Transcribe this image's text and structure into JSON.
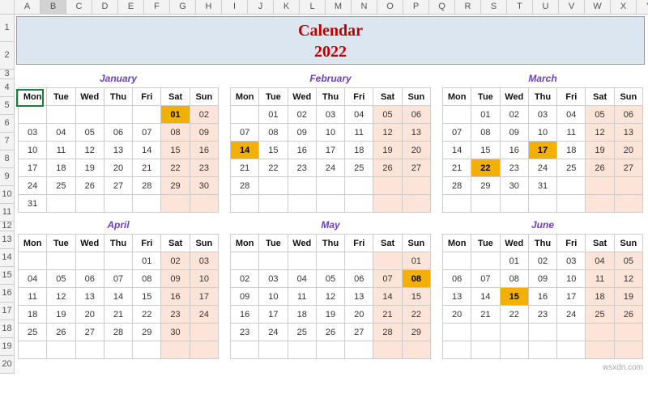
{
  "columns": [
    "A",
    "B",
    "C",
    "D",
    "E",
    "F",
    "G",
    "H",
    "I",
    "J",
    "K",
    "L",
    "M",
    "N",
    "O",
    "P",
    "Q",
    "R",
    "S",
    "T",
    "U",
    "V",
    "W",
    "X",
    "Y"
  ],
  "selected_column": "B",
  "rows": [
    "1",
    "2",
    "3",
    "4",
    "5",
    "6",
    "7",
    "8",
    "9",
    "10",
    "11",
    "12",
    "13",
    "14",
    "15",
    "16",
    "17",
    "18",
    "19",
    "20"
  ],
  "title": {
    "line1": "Calendar",
    "line2": "2022"
  },
  "day_headers": [
    "Mon",
    "Tue",
    "Wed",
    "Thu",
    "Fri",
    "Sat",
    "Sun"
  ],
  "months": [
    {
      "name": "January",
      "weeks": [
        [
          "",
          "",
          "",
          "",
          "",
          "01",
          "02"
        ],
        [
          "03",
          "04",
          "05",
          "06",
          "07",
          "08",
          "09"
        ],
        [
          "10",
          "11",
          "12",
          "13",
          "14",
          "15",
          "16"
        ],
        [
          "17",
          "18",
          "19",
          "20",
          "21",
          "22",
          "23"
        ],
        [
          "24",
          "25",
          "26",
          "27",
          "28",
          "29",
          "30"
        ],
        [
          "31",
          "",
          "",
          "",
          "",
          "",
          ""
        ]
      ],
      "highlights": [
        "01"
      ]
    },
    {
      "name": "February",
      "weeks": [
        [
          "",
          "01",
          "02",
          "03",
          "04",
          "05",
          "06"
        ],
        [
          "07",
          "08",
          "09",
          "10",
          "11",
          "12",
          "13"
        ],
        [
          "14",
          "15",
          "16",
          "17",
          "18",
          "19",
          "20"
        ],
        [
          "21",
          "22",
          "23",
          "24",
          "25",
          "26",
          "27"
        ],
        [
          "28",
          "",
          "",
          "",
          "",
          "",
          ""
        ],
        [
          "",
          "",
          "",
          "",
          "",
          "",
          ""
        ]
      ],
      "highlights": [
        "14"
      ]
    },
    {
      "name": "March",
      "weeks": [
        [
          "",
          "01",
          "02",
          "03",
          "04",
          "05",
          "06"
        ],
        [
          "07",
          "08",
          "09",
          "10",
          "11",
          "12",
          "13"
        ],
        [
          "14",
          "15",
          "16",
          "17",
          "18",
          "19",
          "20"
        ],
        [
          "21",
          "22",
          "23",
          "24",
          "25",
          "26",
          "27"
        ],
        [
          "28",
          "29",
          "30",
          "31",
          "",
          "",
          ""
        ],
        [
          "",
          "",
          "",
          "",
          "",
          "",
          ""
        ]
      ],
      "highlights": [
        "17",
        "22"
      ]
    },
    {
      "name": "April",
      "weeks": [
        [
          "",
          "",
          "",
          "",
          "01",
          "02",
          "03"
        ],
        [
          "04",
          "05",
          "06",
          "07",
          "08",
          "09",
          "10"
        ],
        [
          "11",
          "12",
          "13",
          "14",
          "15",
          "16",
          "17"
        ],
        [
          "18",
          "19",
          "20",
          "21",
          "22",
          "23",
          "24"
        ],
        [
          "25",
          "26",
          "27",
          "28",
          "29",
          "30",
          ""
        ],
        [
          "",
          "",
          "",
          "",
          "",
          "",
          ""
        ]
      ],
      "highlights": []
    },
    {
      "name": "May",
      "weeks": [
        [
          "",
          "",
          "",
          "",
          "",
          "",
          "01"
        ],
        [
          "02",
          "03",
          "04",
          "05",
          "06",
          "07",
          "08"
        ],
        [
          "09",
          "10",
          "11",
          "12",
          "13",
          "14",
          "15"
        ],
        [
          "16",
          "17",
          "18",
          "19",
          "20",
          "21",
          "22"
        ],
        [
          "23",
          "24",
          "25",
          "26",
          "27",
          "28",
          "29"
        ],
        [
          "",
          "",
          "",
          "",
          "",
          "",
          ""
        ]
      ],
      "highlights": [
        "08"
      ]
    },
    {
      "name": "June",
      "weeks": [
        [
          "",
          "",
          "01",
          "02",
          "03",
          "04",
          "05"
        ],
        [
          "06",
          "07",
          "08",
          "09",
          "10",
          "11",
          "12"
        ],
        [
          "13",
          "14",
          "15",
          "16",
          "17",
          "18",
          "19"
        ],
        [
          "20",
          "21",
          "22",
          "23",
          "24",
          "25",
          "26"
        ],
        [
          "",
          "",
          "",
          "",
          "",
          "",
          ""
        ],
        [
          "",
          "",
          "",
          "",
          "",
          "",
          ""
        ]
      ],
      "highlights": [
        "15"
      ]
    }
  ],
  "watermark": "wsxdn.com"
}
